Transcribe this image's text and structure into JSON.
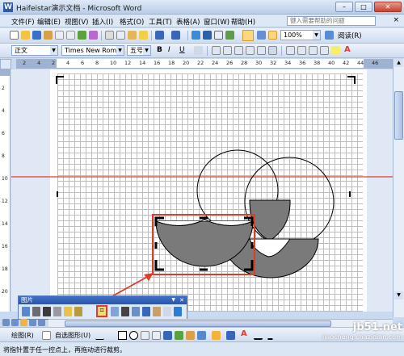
{
  "window": {
    "title": "Haifeistar演示文档 - Microsoft Word",
    "app_icon": "W",
    "minimize": "–",
    "maximize": "□",
    "close": "✕"
  },
  "menu": {
    "items": [
      "文件(F)",
      "编辑(E)",
      "视图(V)",
      "插入(I)",
      "格式(O)",
      "工具(T)",
      "表格(A)",
      "窗口(W)",
      "帮助(H)"
    ],
    "help_placeholder": "键入需要帮助的问题",
    "close": "×"
  },
  "standard_toolbar": {
    "zoom_value": "100%",
    "read_label": "阅读(R)"
  },
  "format_toolbar": {
    "style": "正文",
    "font": "Times New Roman",
    "size": "五号",
    "bold": "B",
    "italic": "I",
    "underline": "U",
    "font_color_glyph": "A"
  },
  "hruler": {
    "numbers": [
      "2",
      "4",
      "2",
      "4",
      "6",
      "8",
      "10",
      "12",
      "14",
      "16",
      "18",
      "20",
      "22",
      "24",
      "26",
      "28",
      "30",
      "32",
      "34",
      "36",
      "38",
      "40",
      "42",
      "44",
      "46"
    ]
  },
  "vruler": {
    "numbers": [
      "2",
      "4",
      "6",
      "8",
      "10",
      "12",
      "14",
      "16",
      "18",
      "20"
    ]
  },
  "picture_toolbar": {
    "title": "图片",
    "close": "✕",
    "dropdown": "▼",
    "crop_glyph": "⌗"
  },
  "drawing_toolbar": {
    "draw_label": "绘图(R)",
    "autoshapes_label": "自选图形(U)",
    "font_color_glyph": "A"
  },
  "status": {
    "text": "将指针置于任一控点上，再拖动进行裁剪。"
  },
  "watermark": {
    "line1": "jb51.net",
    "line2": "jiaocheng.chazidian.com"
  },
  "colors": {
    "accent_red": "#e03c2b",
    "shape_fill_gray": "#7a7a7a",
    "title_blue": "#2a55a8"
  }
}
